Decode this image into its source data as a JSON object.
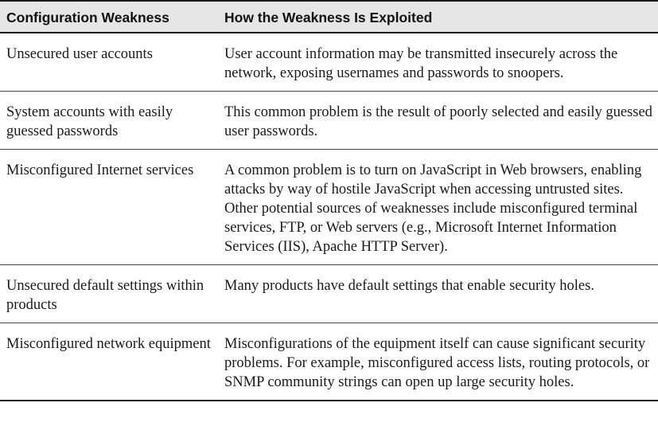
{
  "table": {
    "headers": [
      "Configuration Weakness",
      "How the Weakness Is Exploited"
    ],
    "rows": [
      {
        "weakness": "Unsecured user accounts",
        "exploit": "User account information may be transmitted insecurely across the network, exposing usernames and passwords to snoopers."
      },
      {
        "weakness": "System accounts with easily guessed passwords",
        "exploit": "This common problem is the result of poorly selected and easily guessed user passwords."
      },
      {
        "weakness": "Misconfigured Internet services",
        "exploit": "A common problem is to turn on JavaScript in Web browsers, enabling attacks by way of hostile JavaScript when accessing untrusted sites. Other potential sources of weaknesses include misconfigured terminal services, FTP, or Web servers (e.g., Microsoft Internet Information Services (IIS), Apache HTTP Server)."
      },
      {
        "weakness": "Unsecured default settings within products",
        "exploit": "Many products have default settings that enable security holes."
      },
      {
        "weakness": "Misconfigured network equipment",
        "exploit": "Misconfigurations of the equipment itself can cause significant security problems. For example, misconfigured access lists, routing protocols, or SNMP community strings can open up large security holes."
      }
    ]
  }
}
